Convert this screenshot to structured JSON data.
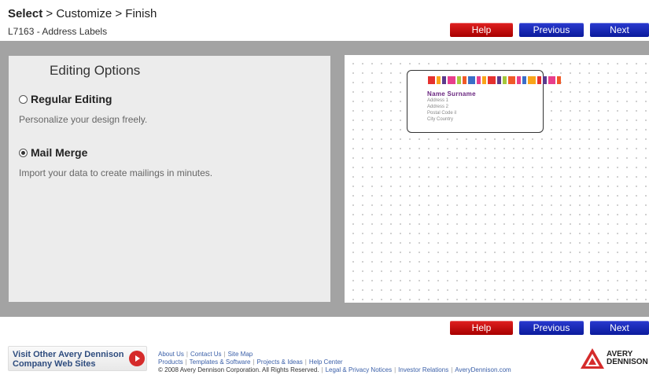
{
  "header": {
    "step_current": "Select",
    "step_sep1": " > ",
    "step_2": "Customize",
    "step_sep2": " > ",
    "step_3": "Finish",
    "subtitle": "L7163 - Address Labels"
  },
  "nav": {
    "help": "Help",
    "previous": "Previous",
    "next": "Next"
  },
  "editing": {
    "title": "Editing Options",
    "regular_label": "Regular Editing",
    "regular_desc": "Personalize your design freely.",
    "merge_label": "Mail Merge",
    "merge_desc": "Import your data to create mailings in minutes.",
    "selected": "Mail Merge"
  },
  "preview": {
    "name": "Name Surname",
    "address1": "Address 1",
    "address2": "Address 2",
    "postal": "Postal Code il",
    "city": "City Country",
    "stripe_colors": [
      "#e5312f",
      "#f9a51a",
      "#5a3a8c",
      "#e83e8c",
      "#a4c83b",
      "#f05a28",
      "#3a6ec8",
      "#e83e8c",
      "#f9a51a",
      "#e5312f",
      "#5a3a8c",
      "#a4c83b",
      "#f05a28",
      "#e83e8c",
      "#3a6ec8",
      "#f9a51a",
      "#e5312f",
      "#5a3a8c",
      "#e83e8c",
      "#f05a28"
    ]
  },
  "footer": {
    "visit_line1": "Visit Other Avery Dennison",
    "visit_line2": "Company Web Sites",
    "links_row1": [
      "About Us",
      "Contact Us",
      "Site Map"
    ],
    "links_row2": [
      "Products",
      "Templates & Software",
      "Projects & Ideas",
      "Help Center"
    ],
    "copyright": "© 2008 Avery Dennison Corporation. All Rights Reserved.",
    "links_row3": [
      "Legal & Privacy Notices",
      "Investor Relations",
      "AveryDennison.com"
    ],
    "logo_line1": "AVERY",
    "logo_line2": "DENNISON",
    "accent": "#d52b2b"
  }
}
